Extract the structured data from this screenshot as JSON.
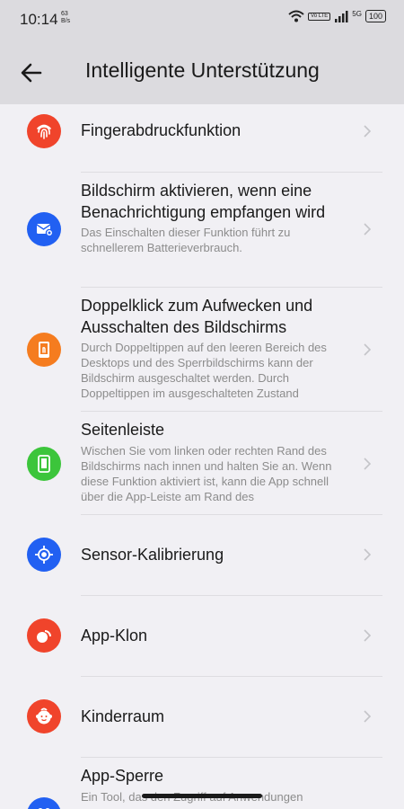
{
  "status_bar": {
    "time": "10:14",
    "net_speed_value": "63",
    "net_speed_unit": "B/s",
    "volte": "Vo LTE",
    "network": "5G",
    "battery": "100"
  },
  "header": {
    "title": "Intelligente Unterstützung",
    "back_icon": "arrow-left-icon"
  },
  "items": [
    {
      "title": "Fingerabdruckfunktion",
      "subtitle": "",
      "icon": "fingerprint-icon",
      "icon_color": "#f0442b"
    },
    {
      "title": "Bildschirm aktivieren, wenn eine Benachrichtigung empfangen wird",
      "subtitle": "Das Einschalten dieser Funktion führt zu schnellerem Batterieverbrauch.",
      "icon": "notification-mail-icon",
      "icon_color": "#2160f2"
    },
    {
      "title": "Doppelklick zum Aufwecken und Ausschalten des Bildschirms",
      "subtitle": "Durch Doppeltippen auf den leeren Bereich des Desktops und des Sperrbildschirms kann der Bildschirm ausgeschaltet werden. Durch Doppeltippen im ausgeschalteten Zustand",
      "icon": "phone-tap-icon",
      "icon_color": "#f57c1f"
    },
    {
      "title": "Seitenleiste",
      "subtitle": "Wischen Sie vom linken oder rechten Rand des Bildschirms nach innen und halten Sie an. Wenn diese Funktion aktiviert ist, kann die App schnell über die App-Leiste am Rand des",
      "icon": "phone-sidebar-icon",
      "icon_color": "#3cc53b"
    },
    {
      "title": "Sensor-Kalibrierung",
      "subtitle": "",
      "icon": "crosshair-icon",
      "icon_color": "#2160f2"
    },
    {
      "title": "App-Klon",
      "subtitle": "",
      "icon": "app-clone-icon",
      "icon_color": "#f0442b"
    },
    {
      "title": "Kinderraum",
      "subtitle": "",
      "icon": "child-face-icon",
      "icon_color": "#f0442b"
    },
    {
      "title": "App-Sperre",
      "subtitle": "Ein Tool, das den Zugriff auf Anwendungen",
      "icon": "app-lock-icon",
      "icon_color": "#2160f2"
    }
  ]
}
